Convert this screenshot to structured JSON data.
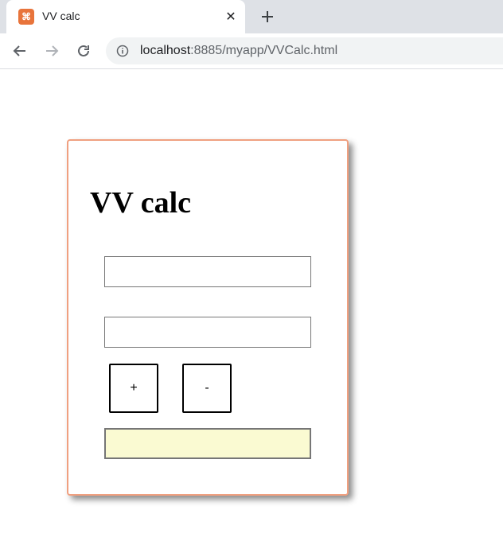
{
  "browser": {
    "tab": {
      "title": "VV calc",
      "favicon_glyph": "⌘",
      "close_glyph": "✕"
    },
    "address": {
      "host": "localhost",
      "rest": ":8885/myapp/VVCalc.html"
    },
    "colors": {
      "tabstrip": "#dee1e6",
      "favicon": "#e8743b"
    }
  },
  "calculator": {
    "title": "VV calc",
    "input1": {
      "value": "",
      "placeholder": ""
    },
    "input2": {
      "value": "",
      "placeholder": ""
    },
    "plus_label": "+",
    "minus_label": "-",
    "result": "",
    "colors": {
      "card_border": "#f0a080",
      "result_bg": "#fafad2"
    }
  }
}
